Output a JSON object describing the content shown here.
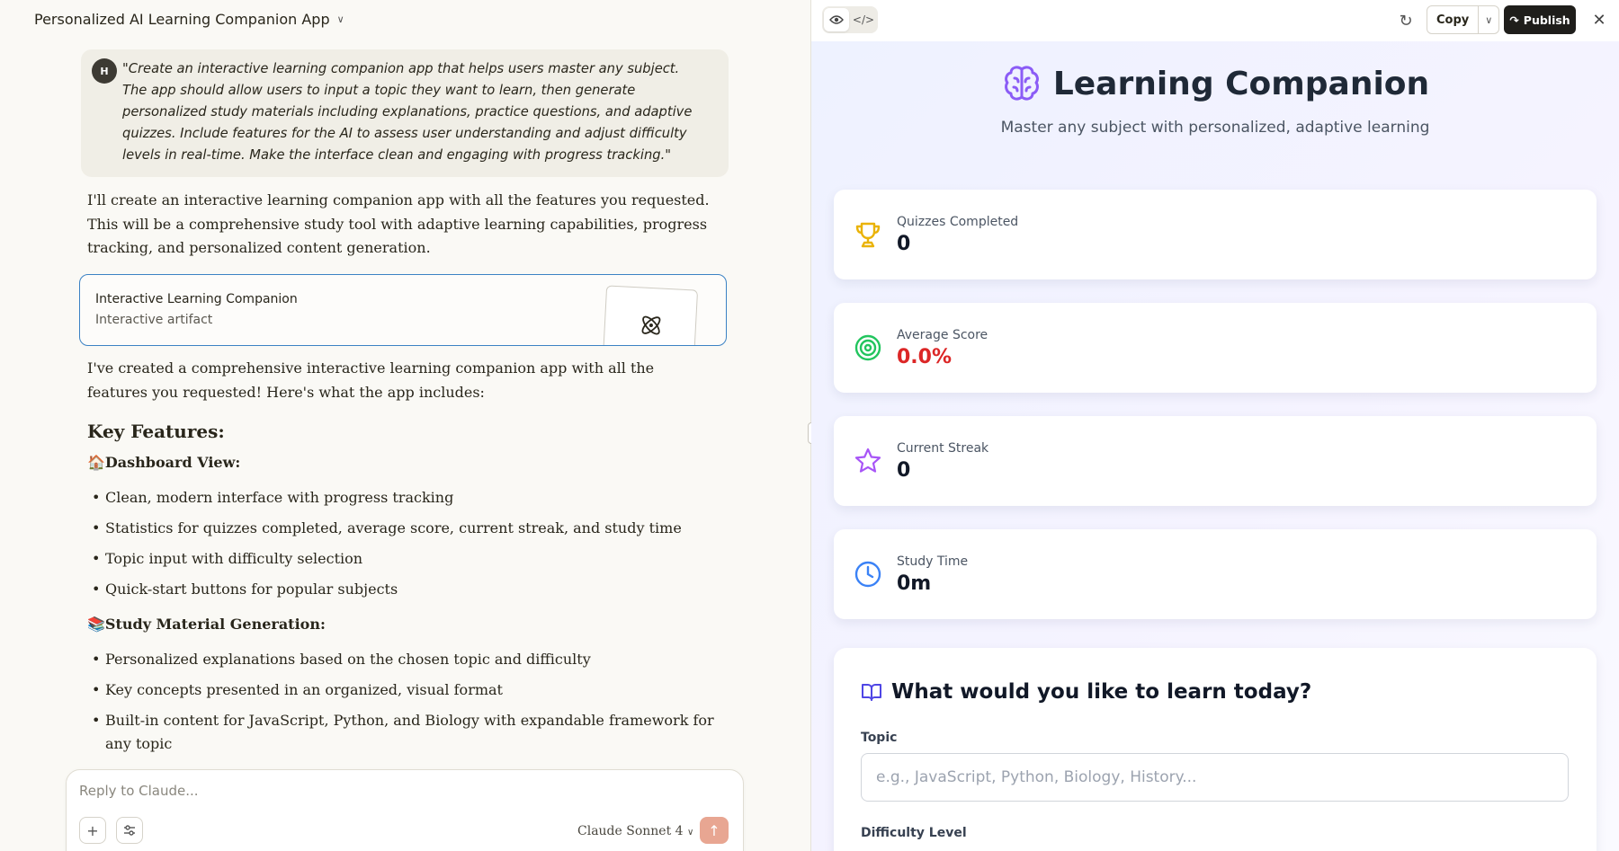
{
  "chat": {
    "title": "Personalized AI Learning Companion App",
    "user_avatar": "H",
    "user_message": "\"Create an interactive learning companion app that helps users master any subject. The app should allow users to input a topic they want to learn, then generate personalized study materials including explanations, practice questions, and adaptive quizzes. Include features for the AI to assess user understanding and adjust difficulty levels in real-time. Make the interface clean and engaging with progress tracking.\"",
    "response_intro": "I'll create an interactive learning companion app with all the features you requested. This will be a comprehensive study tool with adaptive learning capabilities, progress tracking, and personalized content generation.",
    "artifact": {
      "name": "Interactive Learning Companion",
      "type": "Interactive artifact",
      "icon": "atom-icon"
    },
    "response_followup": "I've created a comprehensive interactive learning companion app with all the features you requested! Here's what the app includes:",
    "key_features_heading": "Key Features:",
    "sections": [
      {
        "emoji": "🏠",
        "title": "Dashboard View:",
        "items": [
          "Clean, modern interface with progress tracking",
          "Statistics for quizzes completed, average score, current streak, and study time",
          "Topic input with difficulty selection",
          "Quick-start buttons for popular subjects"
        ]
      },
      {
        "emoji": "📚",
        "title": "Study Material Generation:",
        "items": [
          "Personalized explanations based on the chosen topic and difficulty",
          "Key concepts presented in an organized, visual format",
          "Built-in content for JavaScript, Python, and Biology with expandable framework for any topic"
        ]
      }
    ],
    "composer": {
      "placeholder": "Reply to Claude...",
      "model": "Claude Sonnet 4"
    }
  },
  "artifact_toolbar": {
    "copy_label": "Copy",
    "publish_label": "Publish"
  },
  "app": {
    "title": "Learning Companion",
    "subtitle": "Master any subject with personalized, adaptive learning",
    "stats": [
      {
        "label": "Quizzes Completed",
        "value": "0",
        "icon": "trophy-icon",
        "color": "#eab308"
      },
      {
        "label": "Average Score",
        "value": "0.0%",
        "icon": "target-icon",
        "color": "#22c55e",
        "value_color": "#dc2626"
      },
      {
        "label": "Current Streak",
        "value": "0",
        "icon": "star-icon",
        "color": "#a855f7"
      },
      {
        "label": "Study Time",
        "value": "0m",
        "icon": "clock-icon",
        "color": "#3b82f6"
      }
    ],
    "learn": {
      "heading": "What would you like to learn today?",
      "topic_label": "Topic",
      "topic_placeholder": "e.g., JavaScript, Python, Biology, History...",
      "difficulty_label": "Difficulty Level"
    },
    "colors": {
      "brand": "#8b5cf6",
      "heading_icon": "#4f46e5"
    }
  }
}
